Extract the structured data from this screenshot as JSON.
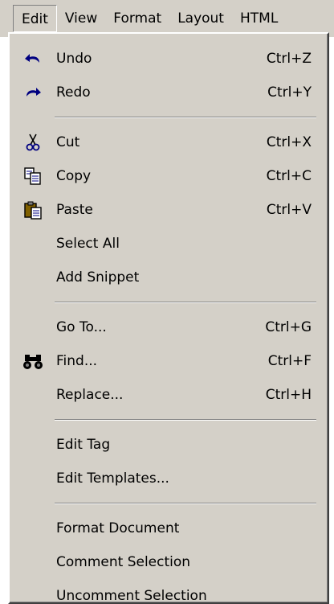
{
  "menubar": {
    "items": [
      "Edit",
      "View",
      "Format",
      "Layout",
      "HTML"
    ]
  },
  "menu": {
    "undo": {
      "label": "Undo",
      "shortcut": "Ctrl+Z",
      "icon": "undo-icon"
    },
    "redo": {
      "label": "Redo",
      "shortcut": "Ctrl+Y",
      "icon": "redo-icon"
    },
    "cut": {
      "label": "Cut",
      "shortcut": "Ctrl+X",
      "icon": "scissors-icon"
    },
    "copy": {
      "label": "Copy",
      "shortcut": "Ctrl+C",
      "icon": "copy-icon"
    },
    "paste": {
      "label": "Paste",
      "shortcut": "Ctrl+V",
      "icon": "paste-icon"
    },
    "select_all": {
      "label": "Select All"
    },
    "add_snippet": {
      "label": "Add Snippet"
    },
    "go_to": {
      "label": "Go To...",
      "shortcut": "Ctrl+G"
    },
    "find": {
      "label": "Find...",
      "shortcut": "Ctrl+F",
      "icon": "binoculars-icon"
    },
    "replace": {
      "label": "Replace...",
      "shortcut": "Ctrl+H"
    },
    "edit_tag": {
      "label": "Edit Tag"
    },
    "edit_templates": {
      "label": "Edit Templates..."
    },
    "format_document": {
      "label": "Format Document"
    },
    "comment_selection": {
      "label": "Comment Selection"
    },
    "uncomment_selection": {
      "label": "Uncomment Selection"
    }
  },
  "colors": {
    "face": "#d4d0c8",
    "shadow": "#808080",
    "highlight": "#ffffff",
    "icon_blue": "#000080"
  }
}
